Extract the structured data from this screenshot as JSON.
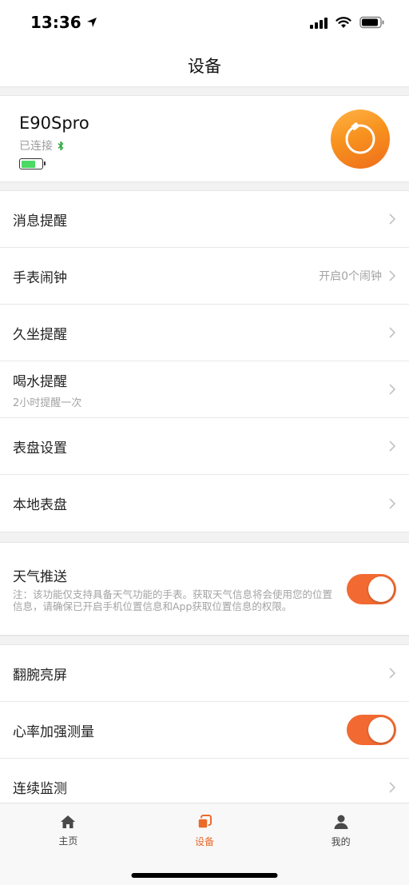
{
  "status_bar": {
    "time": "13:36"
  },
  "nav": {
    "title": "设备"
  },
  "device": {
    "name": "E90Spro",
    "status": "已连接",
    "battery_level": 0.7
  },
  "menu1": [
    {
      "label": "消息提醒",
      "value": ""
    },
    {
      "label": "手表闹钟",
      "value": "开启0个闹钟"
    },
    {
      "label": "久坐提醒",
      "value": ""
    },
    {
      "label": "喝水提醒",
      "sub": "2小时提醒一次",
      "value": ""
    },
    {
      "label": "表盘设置",
      "value": ""
    },
    {
      "label": "本地表盘",
      "value": ""
    }
  ],
  "weather": {
    "label": "天气推送",
    "note": "注：该功能仅支持具备天气功能的手表。获取天气信息将会使用您的位置信息，请确保已开启手机位置信息和App获取位置信息的权限。",
    "enabled": true
  },
  "menu2": [
    {
      "label": "翻腕亮屏",
      "type": "chevron"
    },
    {
      "label": "心率加强测量",
      "type": "toggle",
      "enabled": true
    },
    {
      "label": "连续监测",
      "type": "chevron"
    }
  ],
  "tabs": [
    {
      "label": "主页",
      "icon": "home-icon"
    },
    {
      "label": "设备",
      "icon": "device-icon",
      "active": true
    },
    {
      "label": "我的",
      "icon": "person-icon"
    }
  ],
  "colors": {
    "accent": "#f26a32",
    "tab_active": "#ea6a2a",
    "battery": "#4cd964",
    "bluetooth": "#2aa33a"
  }
}
